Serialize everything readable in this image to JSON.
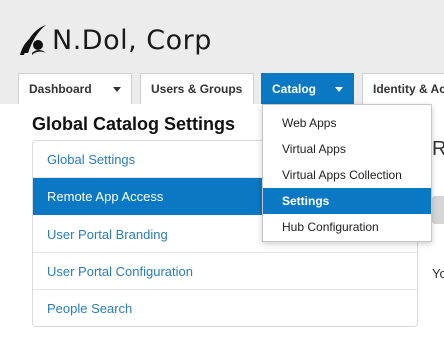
{
  "brand": {
    "name": "N.Dol, Corp"
  },
  "tabs": [
    {
      "label": "Dashboard",
      "has_caret": true
    },
    {
      "label": "Users & Groups",
      "has_caret": false
    },
    {
      "label": "Catalog",
      "has_caret": true,
      "active": true
    },
    {
      "label": "Identity & Acce",
      "has_caret": false
    }
  ],
  "page": {
    "title": "Global Catalog Settings"
  },
  "side_nav": {
    "items": [
      {
        "label": "Global Settings"
      },
      {
        "label": "Remote App Access",
        "active": true
      },
      {
        "label": "User Portal Branding"
      },
      {
        "label": "User Portal Configuration"
      },
      {
        "label": "People Search"
      }
    ]
  },
  "catalog_menu": {
    "items": [
      {
        "label": "Web Apps"
      },
      {
        "label": "Virtual Apps"
      },
      {
        "label": "Virtual Apps Collection"
      },
      {
        "label": "Settings",
        "highlighted": true
      },
      {
        "label": "Hub Configuration"
      }
    ]
  },
  "right_pane": {
    "heading": "R",
    "text": "Yo"
  },
  "colors": {
    "accent": "#0b78c4",
    "header_bg": "#ececec",
    "link": "#2a7cc0"
  }
}
